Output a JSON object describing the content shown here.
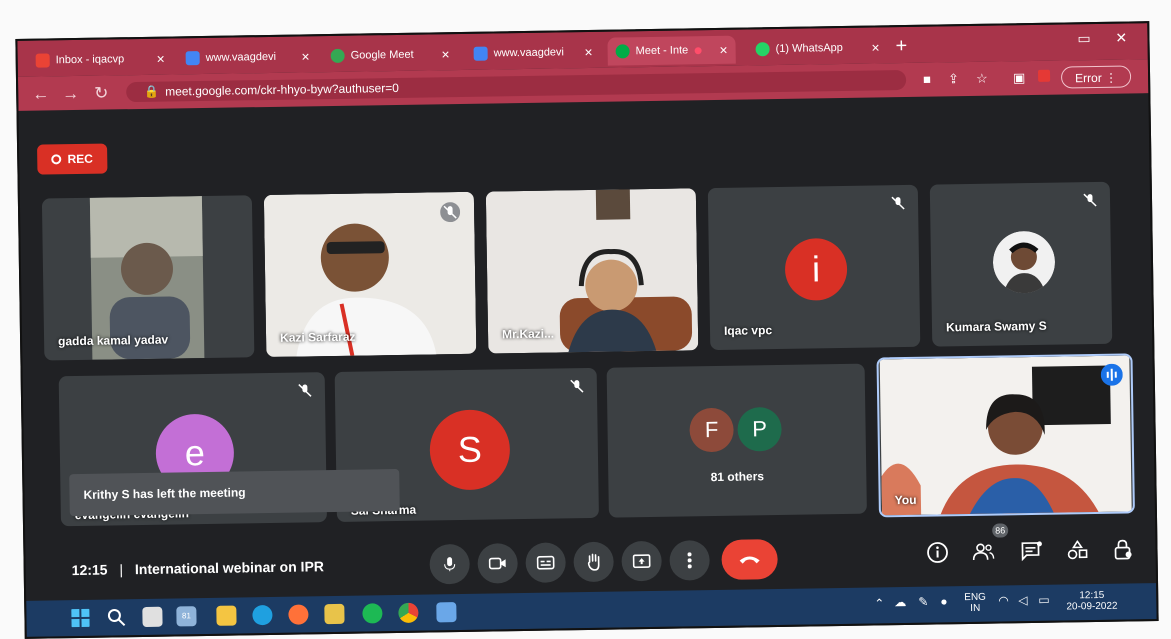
{
  "browser": {
    "tabs": [
      {
        "title": "Inbox - iqacvp",
        "color": "#ea4335"
      },
      {
        "title": "www.vaagdevi",
        "color": "#4285f4"
      },
      {
        "title": "Google Meet",
        "color": "#34a853"
      },
      {
        "title": "www.vaagdevi",
        "color": "#4285f4"
      },
      {
        "title": "Meet - Inte",
        "color": "#00ac47"
      },
      {
        "title": "(1) WhatsApp",
        "color": "#25d366"
      }
    ],
    "url": "meet.google.com/ckr-hhyo-byw?authuser=0",
    "error_label": "Error"
  },
  "meeting": {
    "rec_label": "REC",
    "time": "12:15",
    "separator": "|",
    "title": "International webinar on IPR",
    "participant_badge": "86",
    "toast": "Krithy S has left the meeting",
    "others_label": "81 others",
    "colors": {
      "red": "#d93025",
      "purple": "#c36fd6",
      "brown": "#8d4a3a",
      "green": "#1e6b4c",
      "salmon": "#c5563f"
    }
  },
  "participants": [
    {
      "name": "gadda kamal yadav",
      "muted": false
    },
    {
      "name": "Kazi Sarfaraz",
      "muted": true
    },
    {
      "name": "Mr.Kazi...",
      "muted": false
    },
    {
      "name": "Iqac vpc",
      "initial": "i",
      "muted": true
    },
    {
      "name": "Kumara Swamy S",
      "muted": true
    },
    {
      "name": "evangelin evangelin",
      "initial": "e",
      "muted": true
    },
    {
      "name": "Sai Sharma",
      "initial": "S",
      "muted": true
    },
    {
      "name": "You",
      "muted": false
    }
  ],
  "others": {
    "initials": [
      "F",
      "P"
    ]
  },
  "taskbar": {
    "lang_top": "ENG",
    "lang_bottom": "IN",
    "clock_time": "12:15",
    "clock_date": "20-09-2022",
    "spotify_count": "81"
  }
}
